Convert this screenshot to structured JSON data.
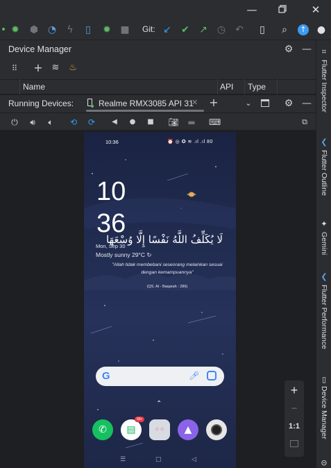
{
  "git_label": "Git:",
  "tool_window": {
    "title": "Device Manager",
    "columns": [
      "Name",
      "API",
      "Type"
    ]
  },
  "running_devices": {
    "label": "Running Devices:",
    "tab": "Realme RMX3085 API 31"
  },
  "phone": {
    "status_time": "10:36",
    "status_icons": "⏰ ◎ ✪ ≋ .ıl .ıl 80",
    "clock_hour": "10",
    "clock_minute": "36",
    "arabic": "لَا يُكَلِّفُ اللَّهُ نَفْسًا إِلَّا وُسْعَهَا",
    "date": "Mon, Sep 30",
    "weather": "Mostly sunny  29°C  ↻",
    "quote": "\"Allah tidak membebani seseorang melainkan sesuai dengan kemampuannya\"",
    "quote_source": "(QS. Al - Baqarah : 286)",
    "badge": "99+"
  },
  "zoom": {
    "plus": "+",
    "minus": "−",
    "one_to_one": "1:1"
  },
  "right_stripe": {
    "flutter_inspector": "Flutter Inspector",
    "flutter_outline": "Flutter Outline",
    "gemini": "Gemini",
    "flutter_performance": "Flutter Performance",
    "device_manager": "Device Manager"
  },
  "colors": {
    "accent_blue": "#3d9bf0",
    "green": "#5fb865",
    "orange": "#e8a33d"
  }
}
